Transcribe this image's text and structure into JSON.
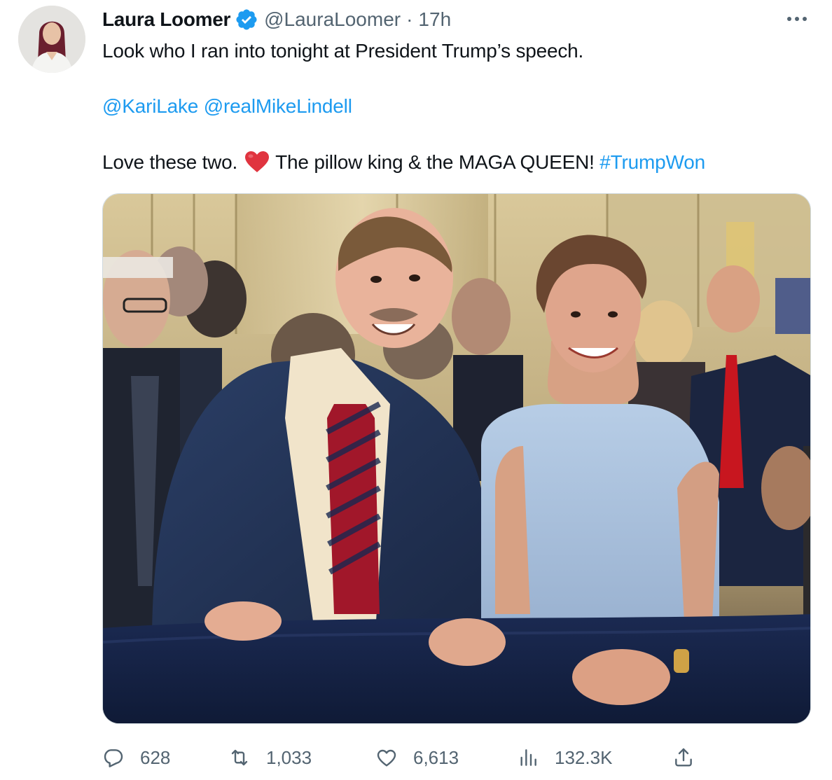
{
  "tweet": {
    "author": {
      "display_name": "Laura Loomer",
      "handle": "@LauraLoomer",
      "separator": "·",
      "time": "17h",
      "verified_color": "#1d9bf0"
    },
    "lines": {
      "line1": "Look who I ran into tonight at President Trump’s speech.",
      "mention1": "@KariLake",
      "mention2": "@realMikeLindell",
      "line3_before_emoji": "Love these two.",
      "line3_after_emoji": "The pillow king & the MAGA QUEEN!",
      "hashtag": "#TrumpWon"
    },
    "emoji": "red-heart",
    "media_alt": "Photo of people at an indoor event",
    "stats": {
      "replies": "628",
      "retweets": "1,033",
      "likes": "6,613",
      "views": "132.3K"
    },
    "colors": {
      "text": "#0f1419",
      "secondary": "#536471",
      "link": "#1d9bf0",
      "heart": "#e0343f"
    },
    "icons": [
      "verified-badge-icon",
      "more-icon",
      "reply-icon",
      "retweet-icon",
      "like-icon",
      "views-icon",
      "share-icon"
    ]
  }
}
